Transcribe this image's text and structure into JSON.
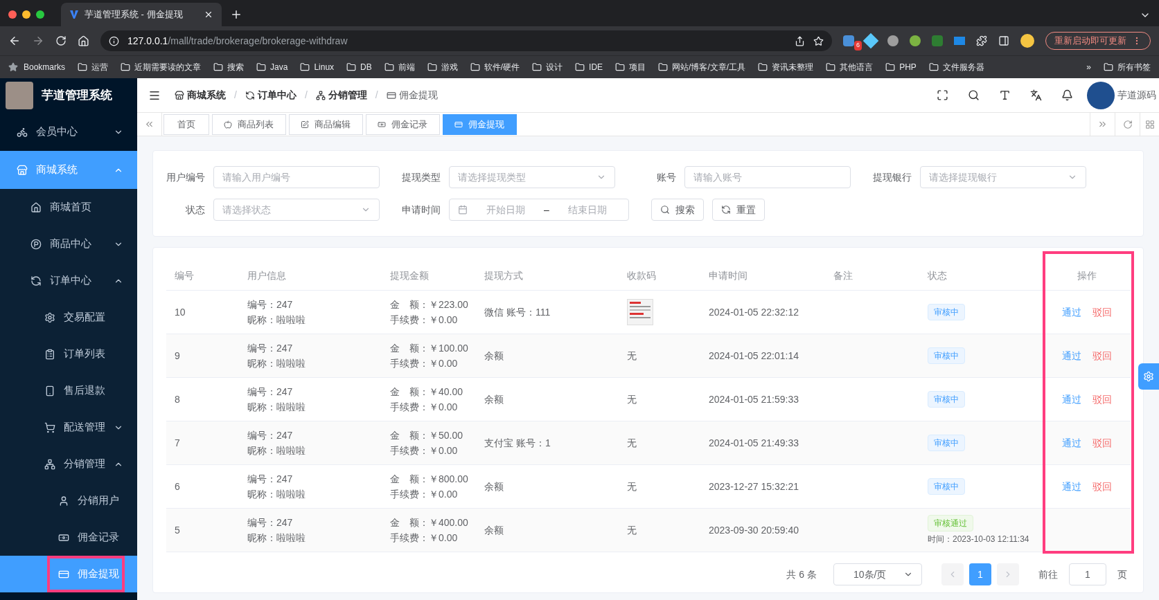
{
  "browser": {
    "tab_title": "芋道管理系统 - 佣金提现",
    "url_host": "127.0.0.1",
    "url_path": "/mall/trade/brokerage/brokerage-withdraw",
    "extension_badge": "6",
    "update_button": "重新启动即可更新",
    "bookmarks_label": "Bookmarks",
    "bookmarks": [
      "运营",
      "近期需要读的文章",
      "搜索",
      "Java",
      "Linux",
      "DB",
      "前端",
      "游戏",
      "软件/硬件",
      "设计",
      "IDE",
      "项目",
      "网站/博客/文章/工具",
      "资讯未整理",
      "其他语言",
      "PHP",
      "文件服务器"
    ],
    "bookmarks_more": "»",
    "all_bookmarks": "所有书签"
  },
  "app": {
    "title": "芋道管理系统",
    "user": "芋道源码"
  },
  "sidebar": {
    "items": [
      {
        "label": "会员中心",
        "expanded": false,
        "selected": false
      },
      {
        "label": "商城系统",
        "expanded": true,
        "selected": true,
        "children": [
          {
            "label": "商城首页",
            "selected": false
          },
          {
            "label": "商品中心",
            "expanded": false,
            "selected": false
          },
          {
            "label": "订单中心",
            "expanded": true,
            "selected": false,
            "children": [
              {
                "label": "交易配置",
                "selected": false
              },
              {
                "label": "订单列表",
                "selected": false
              },
              {
                "label": "售后退款",
                "selected": false
              },
              {
                "label": "配送管理",
                "expanded": false,
                "selected": false
              },
              {
                "label": "分销管理",
                "expanded": true,
                "selected": false,
                "children": [
                  {
                    "label": "分销用户",
                    "selected": false
                  },
                  {
                    "label": "佣金记录",
                    "selected": false
                  },
                  {
                    "label": "佣金提现",
                    "selected": true
                  }
                ]
              }
            ]
          }
        ]
      }
    ]
  },
  "breadcrumbs": [
    "商城系统",
    "订单中心",
    "分销管理",
    "佣金提现"
  ],
  "breadcrumb_separator": "/",
  "tabs": [
    {
      "label": "首页",
      "selected": false
    },
    {
      "label": "商品列表",
      "selected": false
    },
    {
      "label": "商品编辑",
      "selected": false
    },
    {
      "label": "佣金记录",
      "selected": false
    },
    {
      "label": "佣金提现",
      "selected": true
    }
  ],
  "filters": [
    {
      "label": "用户编号",
      "kind": "input",
      "placeholder": "请输入用户编号"
    },
    {
      "label": "提现类型",
      "kind": "select",
      "placeholder": "请选择提现类型"
    },
    {
      "label": "账号",
      "kind": "input",
      "placeholder": "请输入账号"
    },
    {
      "label": "提现银行",
      "kind": "select",
      "placeholder": "请选择提现银行"
    },
    {
      "label": "状态",
      "kind": "select",
      "placeholder": "请选择状态"
    },
    {
      "label": "申请时间",
      "kind": "daterange",
      "placeholder": "开始日期",
      "placeholder_end": "结束日期",
      "separator": "–"
    }
  ],
  "filter_buttons": [
    {
      "label": "搜索",
      "kind": "search"
    },
    {
      "label": "重置",
      "kind": "reset"
    }
  ],
  "table": {
    "columns": [
      "编号",
      "用户信息",
      "提现金额",
      "提现方式",
      "收款码",
      "申请时间",
      "备注",
      "状态",
      "操作"
    ],
    "rows": [
      {
        "id": "10",
        "user_no": "编号：247",
        "nickname": "昵称：啦啦啦",
        "amount": "金　额：￥223.00",
        "fee": "手续费：￥0.00",
        "method": "微信 账号：111",
        "receipt": {
          "kind": "image"
        },
        "time": "2024-01-05 22:32:12",
        "status": {
          "kind": "pending",
          "text": "审核中"
        },
        "actions": [
          {
            "kind": "approve",
            "label": "通过"
          },
          {
            "kind": "reject",
            "label": "驳回"
          }
        ]
      },
      {
        "id": "9",
        "user_no": "编号：247",
        "nickname": "昵称：啦啦啦",
        "amount": "金　额：￥100.00",
        "fee": "手续费：￥0.00",
        "method": "余额",
        "receipt": {
          "kind": "text",
          "text": "无"
        },
        "time": "2024-01-05 22:01:14",
        "status": {
          "kind": "pending",
          "text": "审核中"
        },
        "actions": [
          {
            "kind": "approve",
            "label": "通过"
          },
          {
            "kind": "reject",
            "label": "驳回"
          }
        ]
      },
      {
        "id": "8",
        "user_no": "编号：247",
        "nickname": "昵称：啦啦啦",
        "amount": "金　额：￥40.00",
        "fee": "手续费：￥0.00",
        "method": "余额",
        "receipt": {
          "kind": "text",
          "text": "无"
        },
        "time": "2024-01-05 21:59:33",
        "status": {
          "kind": "pending",
          "text": "审核中"
        },
        "actions": [
          {
            "kind": "approve",
            "label": "通过"
          },
          {
            "kind": "reject",
            "label": "驳回"
          }
        ]
      },
      {
        "id": "7",
        "user_no": "编号：247",
        "nickname": "昵称：啦啦啦",
        "amount": "金　额：￥50.00",
        "fee": "手续费：￥0.00",
        "method": "支付宝 账号：1",
        "receipt": {
          "kind": "text",
          "text": "无"
        },
        "time": "2024-01-05 21:49:33",
        "status": {
          "kind": "pending",
          "text": "审核中"
        },
        "actions": [
          {
            "kind": "approve",
            "label": "通过"
          },
          {
            "kind": "reject",
            "label": "驳回"
          }
        ]
      },
      {
        "id": "6",
        "user_no": "编号：247",
        "nickname": "昵称：啦啦啦",
        "amount": "金　额：￥800.00",
        "fee": "手续费：￥0.00",
        "method": "余额",
        "receipt": {
          "kind": "text",
          "text": "无"
        },
        "time": "2023-12-27 15:32:21",
        "status": {
          "kind": "pending",
          "text": "审核中"
        },
        "actions": [
          {
            "kind": "approve",
            "label": "通过"
          },
          {
            "kind": "reject",
            "label": "驳回"
          }
        ]
      },
      {
        "id": "5",
        "user_no": "编号：247",
        "nickname": "昵称：啦啦啦",
        "amount": "金　额：￥400.00",
        "fee": "手续费：￥0.00",
        "method": "余额",
        "receipt": {
          "kind": "text",
          "text": "无"
        },
        "time": "2023-09-30 20:59:40",
        "status": {
          "kind": "approved",
          "text": "审核通过",
          "time": "时间：2023-10-03 12:11:34"
        }
      }
    ]
  },
  "pagination": {
    "total": "共 6 条",
    "page_size": "10条/页",
    "pages": [
      {
        "label": "1",
        "selected": true
      }
    ],
    "goto_label": "前往",
    "goto_value": "1",
    "goto_suffix": "页"
  },
  "annotation_frames": {
    "actions_column": true,
    "active_menu_item": true
  }
}
